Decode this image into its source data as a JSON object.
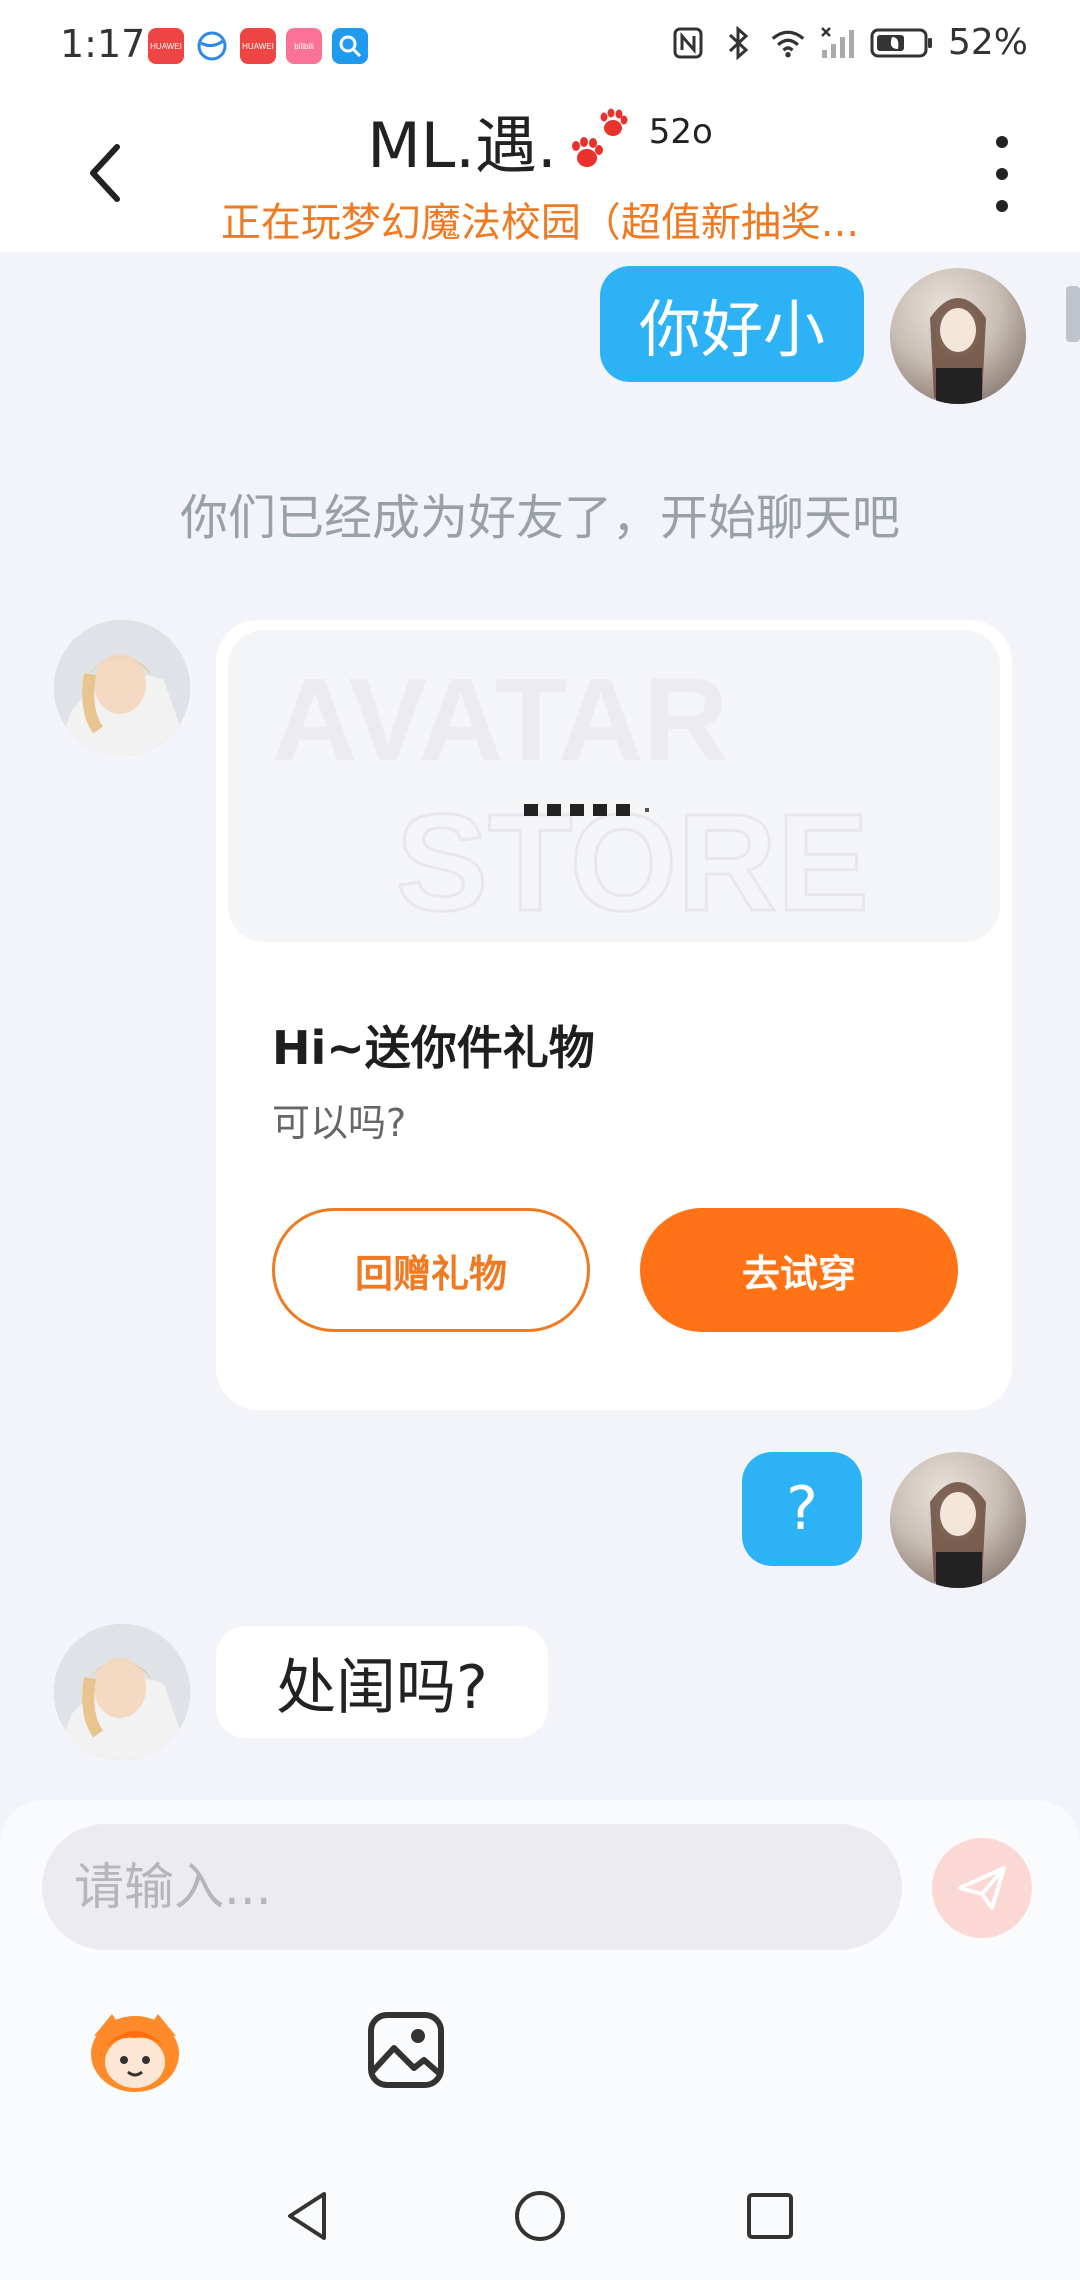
{
  "status_bar": {
    "time": "1:17",
    "battery": "52%",
    "apps": [
      {
        "icon": "huawei-appgallery-icon",
        "label": "HUAWEI",
        "color": "#ee4444"
      },
      {
        "icon": "browser-icon",
        "label": "",
        "color": "#2e8ae6"
      },
      {
        "icon": "huawei-store-icon",
        "label": "HUAWEI",
        "color": "#ee4444"
      },
      {
        "icon": "bilibili-icon",
        "label": "bilibili",
        "color": "#fb7299"
      },
      {
        "icon": "search-app-icon",
        "label": "",
        "color": "#1e9bef"
      }
    ]
  },
  "header": {
    "name": "ML.遇.",
    "badge": "52o",
    "subtitle": "正在玩梦幻魔法校园（超值新抽奖...",
    "subtitle_color": "#f07a22"
  },
  "chat": {
    "messages": {
      "msg1": "你好小",
      "system": "你们已经成为好友了，开始聊天吧",
      "msg2": "?",
      "msg3": "处闺吗?"
    },
    "gift_card": {
      "watermark_line1": "AVATAR",
      "watermark_line2": "STORE",
      "title": "Hi~送你件礼物",
      "subtitle": "可以吗?",
      "btn_return": "回赠礼物",
      "btn_try": "去试穿",
      "accent_color": "#ff7316"
    }
  },
  "input": {
    "placeholder": "请输入..."
  },
  "colors": {
    "bubble_blue": "#2db3f5",
    "background": "#f2f4f9"
  }
}
